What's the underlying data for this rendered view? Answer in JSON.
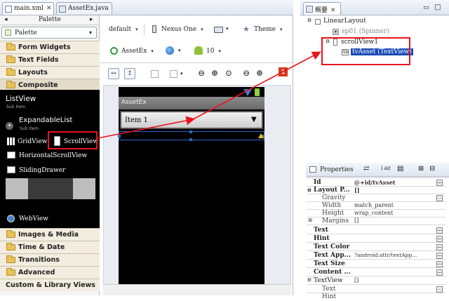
{
  "tabs": {
    "main_xml": "main.xml",
    "assetex_java": "AssetEx.java",
    "overview": "概要"
  },
  "palette": {
    "title": "Palette",
    "selector": "Palette",
    "collapse": "◂",
    "expand": "▸",
    "categories_top": [
      "Form Widgets",
      "Text Fields",
      "Layouts",
      "Composite"
    ],
    "composite_items": {
      "listview": "ListView",
      "listview_sub": "Sub Item",
      "expandable": "ExpandableList",
      "expandable_sub": "Sub Item",
      "gridview": "GridView",
      "scrollview": "ScrollView",
      "hscroll": "HorizontalScrollView",
      "sliding": "SlidingDrawer",
      "webview": "WebView"
    },
    "categories_bottom": [
      "Images & Media",
      "Time & Date",
      "Transitions",
      "Advanced"
    ],
    "custom": "Custom & Library Views"
  },
  "toolbar": {
    "config": "default",
    "device": "Nexus One",
    "theme": "Theme",
    "activity": "AssetEx",
    "api": "10",
    "error_count": "1"
  },
  "canvas": {
    "app_title": "AssetEx",
    "spinner_value": "Item 1"
  },
  "outline": {
    "root": "LinearLayout",
    "spinner": "sp01 (Spinner)",
    "scrollview": "scrollView1",
    "textview": "tvAsset (TextView)"
  },
  "properties": {
    "title": "Properties",
    "rows": [
      {
        "k": "Id",
        "v": "@+id/tvAsset",
        "bold": true,
        "btn": true
      },
      {
        "k": "Layout P...",
        "v": "[]",
        "bold": true,
        "btn": false
      },
      {
        "k": "Gravity",
        "v": "",
        "bold": false,
        "btn": true,
        "indent": true
      },
      {
        "k": "Width",
        "v": "match_parent",
        "bold": false,
        "btn": false,
        "indent": true
      },
      {
        "k": "Height",
        "v": "wrap_content",
        "bold": false,
        "btn": false,
        "indent": true
      },
      {
        "k": "Margins",
        "v": "[]",
        "bold": false,
        "btn": false,
        "indent": true
      },
      {
        "k": "Text",
        "v": "",
        "bold": true,
        "btn": true
      },
      {
        "k": "Hint",
        "v": "",
        "bold": true,
        "btn": true
      },
      {
        "k": "Text Color",
        "v": "",
        "bold": true,
        "btn": true
      },
      {
        "k": "Text App...",
        "v": "?android:attr/textApp...",
        "bold": true,
        "btn": true
      },
      {
        "k": "Text Size",
        "v": "",
        "bold": true,
        "btn": true
      },
      {
        "k": "Content ...",
        "v": "",
        "bold": true,
        "btn": true
      },
      {
        "k": "TextView",
        "v": "[]",
        "bold": false,
        "btn": false
      },
      {
        "k": "Text",
        "v": "",
        "bold": false,
        "btn": true,
        "indent": true
      },
      {
        "k": "Hint",
        "v": "",
        "bold": false,
        "btn": true,
        "indent": true
      }
    ]
  },
  "colors": {
    "highlight": "#e8141b",
    "selection": "#1a4bb5",
    "error": "#d9381e"
  }
}
